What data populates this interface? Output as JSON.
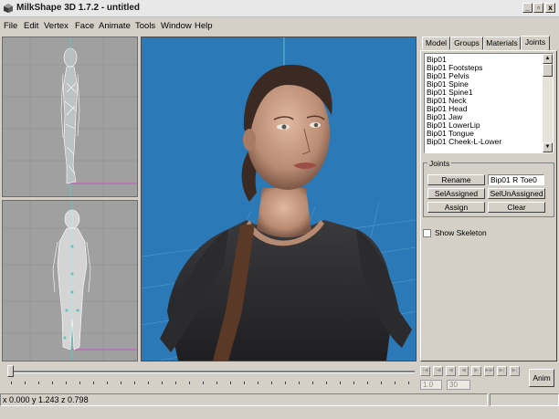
{
  "window": {
    "title": "MilkShape 3D 1.7.2 - untitled",
    "minimize": "_",
    "restore": "▫",
    "close": "x"
  },
  "menu": [
    "File",
    "Edit",
    "Vertex",
    "Face",
    "Animate",
    "Tools",
    "Window",
    "Help"
  ],
  "tabs": [
    "Model",
    "Groups",
    "Materials",
    "Joints"
  ],
  "active_tab": "Joints",
  "joints_list": [
    "Bip01",
    "Bip01 Footsteps",
    "Bip01 Pelvis",
    "Bip01 Spine",
    "Bip01 Spine1",
    "Bip01 Neck",
    "Bip01 Head",
    "Bip01 Jaw",
    "Bip01 LowerLip",
    "Bip01 Tongue",
    "Bip01 Cheek-L-Lower"
  ],
  "joints_group": {
    "label": "Joints",
    "rename_button": "Rename",
    "name_value": "Bip01 R Toe0",
    "sel_assigned_button": "SelAssigned",
    "sel_unassigned_button": "SelUnAssigned",
    "assign_button": "Assign",
    "clear_button": "Clear"
  },
  "show_skeleton": {
    "label": "Show Skeleton",
    "checked": false
  },
  "timeline": {
    "playback_buttons": [
      "|◀",
      "|◀",
      "◀",
      "◀",
      "▶",
      "▶▶",
      "▶|",
      "▶|"
    ],
    "frame_start": "1.0",
    "frame_end": "30",
    "anim_button": "Anim"
  },
  "status": {
    "coordinates": "x 0.000 y 1.243 z 0.798"
  },
  "colors": {
    "viewport_bg": "#2b79b6",
    "side_viewport_bg": "#a0a0a0",
    "ui_bg": "#d4d0c8"
  }
}
